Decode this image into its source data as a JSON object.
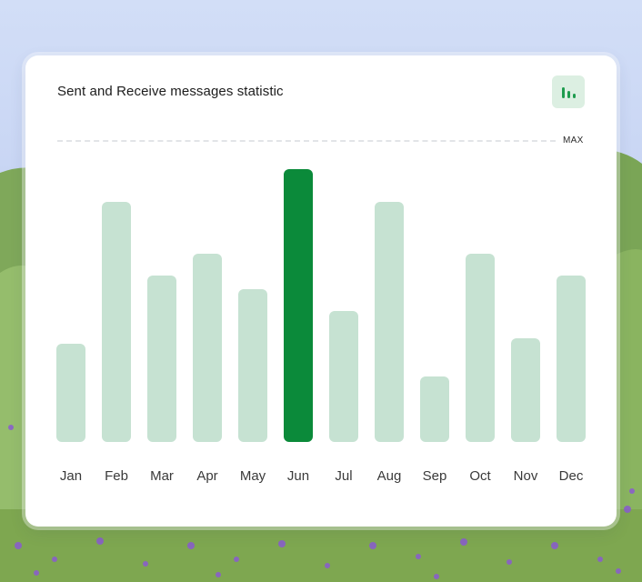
{
  "card": {
    "title": "Sent and Receive messages statistic",
    "max_label": "MAX",
    "chart_button_icon": "bar-chart-icon"
  },
  "colors": {
    "bar_default": "#c6e2d2",
    "bar_highlight": "#0b8a3a",
    "icon_green": "#1e9c4e",
    "icon_bg": "#dcefe2",
    "month_label": "#3a3a3a"
  },
  "chart_data": {
    "type": "bar",
    "title": "Sent and Receive messages statistic",
    "categories": [
      "Jan",
      "Feb",
      "Mar",
      "Apr",
      "May",
      "Jun",
      "Jul",
      "Aug",
      "Sep",
      "Oct",
      "Nov",
      "Dec"
    ],
    "values": [
      36,
      88,
      61,
      69,
      56,
      100,
      48,
      88,
      24,
      69,
      38,
      61
    ],
    "highlighted": "Jun",
    "ylim": [
      0,
      100
    ],
    "reference_line": "MAX",
    "grid": false,
    "xlabel": "",
    "ylabel": ""
  }
}
